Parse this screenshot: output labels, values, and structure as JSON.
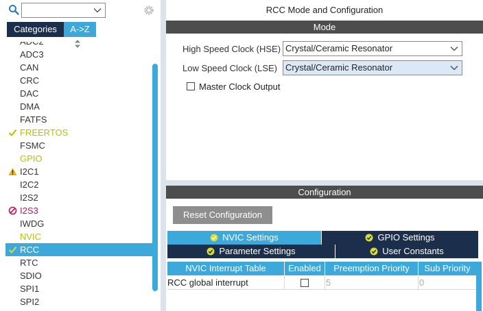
{
  "left_panel": {
    "search": {
      "value": "",
      "placeholder": ""
    },
    "tabs": {
      "categories": "Categories",
      "az": "A->Z"
    },
    "items": [
      {
        "label": "ADC2",
        "status": "none"
      },
      {
        "label": "ADC3",
        "status": "none"
      },
      {
        "label": "CAN",
        "status": "none"
      },
      {
        "label": "CRC",
        "status": "none"
      },
      {
        "label": "DAC",
        "status": "none"
      },
      {
        "label": "DMA",
        "status": "none"
      },
      {
        "label": "FATFS",
        "status": "none"
      },
      {
        "label": "FREERTOS",
        "status": "ok"
      },
      {
        "label": "FSMC",
        "status": "none"
      },
      {
        "label": "GPIO",
        "status": "green"
      },
      {
        "label": "I2C1",
        "status": "warning"
      },
      {
        "label": "I2C2",
        "status": "none"
      },
      {
        "label": "I2S2",
        "status": "none"
      },
      {
        "label": "I2S3",
        "status": "disabled"
      },
      {
        "label": "IWDG",
        "status": "none"
      },
      {
        "label": "NVIC",
        "status": "green"
      },
      {
        "label": "RCC",
        "status": "selected"
      },
      {
        "label": "RTC",
        "status": "none"
      },
      {
        "label": "SDIO",
        "status": "none"
      },
      {
        "label": "SPI1",
        "status": "none"
      },
      {
        "label": "SPI2",
        "status": "none"
      }
    ]
  },
  "right_panel": {
    "title": "RCC Mode and Configuration",
    "mode": {
      "header": "Mode",
      "hse_label": "High Speed Clock (HSE)",
      "hse_value": "Crystal/Ceramic Resonator",
      "lse_label": "Low Speed Clock (LSE)",
      "lse_value": "Crystal/Ceramic Resonator",
      "mco_label": "Master Clock Output",
      "mco_checked": false
    },
    "configuration": {
      "header": "Configuration",
      "reset_label": "Reset Configuration",
      "tabs": {
        "nvic": "NVIC Settings",
        "gpio": "GPIO Settings",
        "params": "Parameter Settings",
        "user": "User Constants"
      },
      "table": {
        "columns": [
          "NVIC Interrupt Table",
          "Enabled",
          "Preemption Priority",
          "Sub Priority"
        ],
        "rows": [
          {
            "name": "RCC global interrupt",
            "enabled": false,
            "preemption": "5",
            "sub": "0"
          }
        ]
      }
    }
  },
  "colors": {
    "accent": "#3da8da",
    "dark_tab": "#1b2e4b",
    "section_header": "#4d4d4d",
    "ok_green": "#b8c000",
    "warning": "#f0b400",
    "disabled": "#c0105a"
  }
}
